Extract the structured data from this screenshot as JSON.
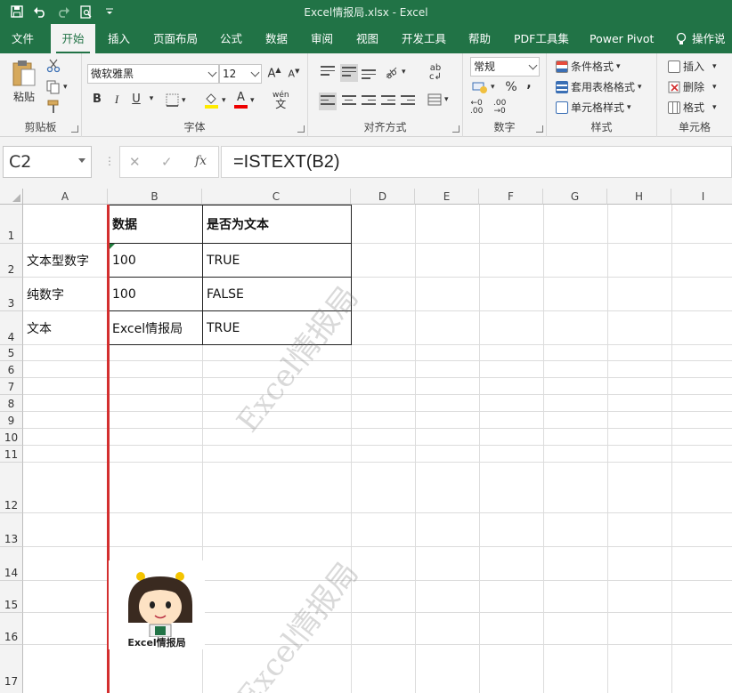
{
  "title_bar": {
    "title": "Excel情报局.xlsx  -  Excel"
  },
  "tabs": [
    "文件",
    "开始",
    "插入",
    "页面布局",
    "公式",
    "数据",
    "审阅",
    "视图",
    "开发工具",
    "帮助",
    "PDF工具集",
    "Power Pivot",
    "操作说"
  ],
  "active_tab": "开始",
  "ribbon": {
    "clipboard": {
      "label": "剪贴板",
      "paste": "粘贴"
    },
    "font": {
      "label": "字体",
      "font_name": "微软雅黑",
      "font_size": "12",
      "bold": "B",
      "italic": "I",
      "underline": "U",
      "grow": "A",
      "shrink": "A",
      "font_color": "A",
      "phonetic": "wén"
    },
    "alignment": {
      "label": "对齐方式"
    },
    "number": {
      "label": "数字",
      "format": "常规",
      "percent": "%",
      "comma": ",",
      "inc_decimal": ".00",
      "dec_decimal": ".00"
    },
    "styles": {
      "label": "样式",
      "conditional": "条件格式",
      "table": "套用表格格式",
      "cell_styles": "单元格样式"
    },
    "cells": {
      "label": "单元格",
      "insert": "插入",
      "delete": "删除",
      "format": "格式"
    }
  },
  "formula_bar": {
    "name_box": "C2",
    "fx": "fx",
    "formula": "=ISTEXT(B2)"
  },
  "columns": [
    "A",
    "B",
    "C",
    "D",
    "E",
    "F",
    "G",
    "H",
    "I"
  ],
  "rows": [
    "1",
    "2",
    "3",
    "4",
    "5",
    "6",
    "7",
    "8",
    "9",
    "10",
    "11",
    "12",
    "13",
    "14",
    "15",
    "16",
    "17"
  ],
  "cells": {
    "B1": "数据",
    "C1": "是否为文本",
    "A2": "文本型数字",
    "B2": "100",
    "C2": "TRUE",
    "A3": "纯数字",
    "B3": "100",
    "C3": "FALSE",
    "A4": "文本",
    "B4": "Excel情报局",
    "C4": "TRUE"
  },
  "watermark": "Excel情报局",
  "logo_text": "Excel情报局",
  "colors": {
    "excel_green": "#217346",
    "selection_bar": "#d32f2f"
  }
}
